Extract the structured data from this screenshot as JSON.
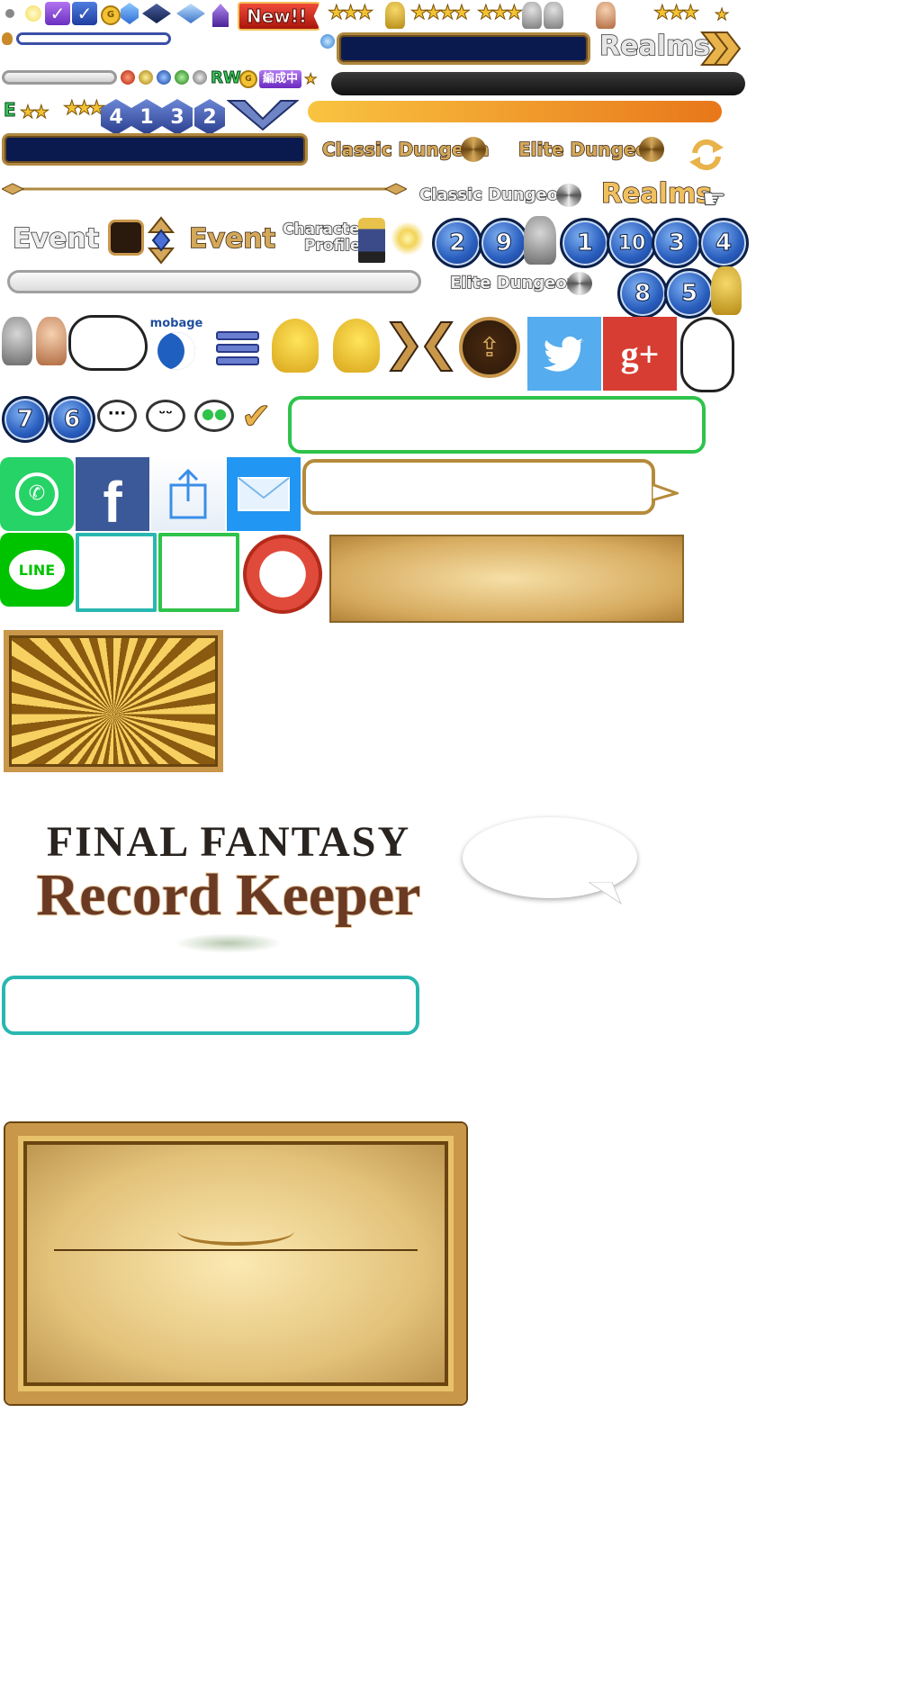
{
  "badges": {
    "new_label": "New!!",
    "rw_label": "RW",
    "edit_label": "編成中",
    "e_label": "E"
  },
  "banners": {
    "realms_1": "Realms",
    "realms_2": "Realms",
    "classic_gold": "Classic Dungeon",
    "elite_gold": "Elite Dungeon",
    "classic_grey": "Classic Dungeon",
    "elite_grey": "Elite Dungeon",
    "event_1": "Event",
    "event_2": "Event",
    "character_profile_line1": "Character",
    "character_profile_line2": "Profile"
  },
  "hex_numbers": [
    "4",
    "1",
    "3",
    "2"
  ],
  "round_numbers_row1": [
    "2",
    "9",
    "1",
    "10",
    "3",
    "4"
  ],
  "round_numbers_row2": [
    "8",
    "5"
  ],
  "round_numbers_row3": [
    "7",
    "6"
  ],
  "social": {
    "mobage_label": "mobage",
    "line_label": "LINE",
    "gplus_label": "g+"
  },
  "logo": {
    "line1": "FINAL FANTASY",
    "line2": "Record Keeper"
  },
  "colors": {
    "navy": "#0b1a4e",
    "gold": "#d4a85a",
    "green_frame": "#2ec34a",
    "teal_frame": "#29b7b0",
    "twitter": "#55acee",
    "gplus": "#d73d32",
    "facebook": "#3b5998",
    "whatsapp": "#25d366",
    "line": "#00c300",
    "mail": "#2196f3"
  }
}
